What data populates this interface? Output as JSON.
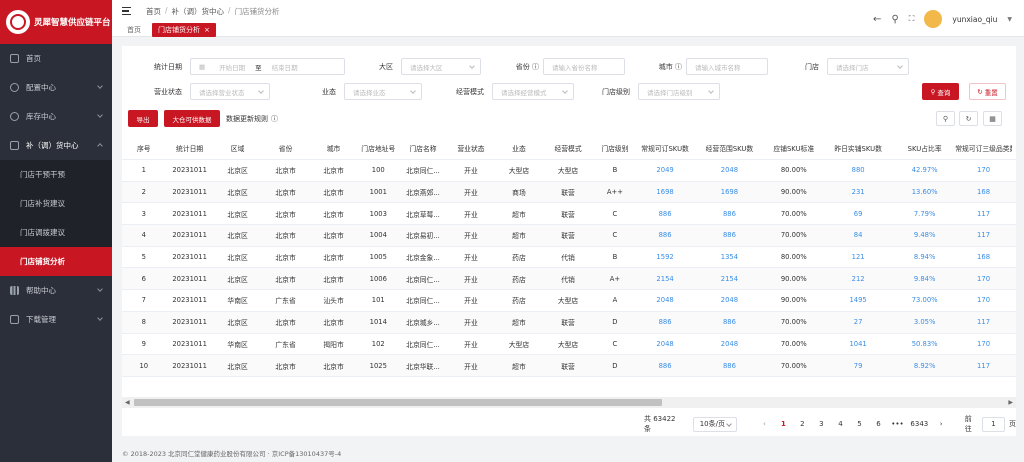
{
  "brand": {
    "name": "灵犀智慧供应链平台"
  },
  "sidebar": {
    "items": [
      {
        "label": "首页"
      },
      {
        "label": "配置中心"
      },
      {
        "label": "库存中心"
      },
      {
        "label": "补（调）货中心"
      },
      {
        "label": "帮助中心"
      },
      {
        "label": "下载管理"
      }
    ],
    "sub_items": [
      {
        "label": "门店干预干预"
      },
      {
        "label": "门店补货建议"
      },
      {
        "label": "门店调拨建议"
      },
      {
        "label": "门店铺货分析"
      }
    ]
  },
  "header": {
    "breadcrumb": [
      "首页",
      "补（调）货中心",
      "门店铺货分析"
    ],
    "tabs": [
      {
        "label": "首页"
      },
      {
        "label": "门店铺货分析"
      }
    ],
    "username": "yunxiao_qiu"
  },
  "filters": {
    "stat_date": "统计日期",
    "start_ph": "开始日期",
    "to": "至",
    "end_ph": "结束日期",
    "region": "大区",
    "region_ph": "请选择大区",
    "province": "省份",
    "province_ph": "请输入省份名称",
    "city": "城市",
    "city_ph": "请输入城市名称",
    "store": "门店",
    "store_ph": "请选择门店",
    "status": "营业状态",
    "status_ph": "请选择营业状态",
    "format": "业态",
    "format_ph": "请选择业态",
    "mode": "经营模式",
    "mode_ph": "请选择经营模式",
    "level": "门店级别",
    "level_ph": "请选择门店级别",
    "query": "查询",
    "reset": "重置"
  },
  "toolbar": {
    "export": "导出",
    "contract": "大仓可供数据",
    "rule": "数据更新规则"
  },
  "table": {
    "columns": [
      "序号",
      "统计日期",
      "区域",
      "省份",
      "城市",
      "门店地址号",
      "门店名称",
      "营业状态",
      "业态",
      "经营模式",
      "门店级别",
      "常规可订SKU数",
      "经营范围SKU数",
      "应铺SKU标准",
      "昨日实铺SKU数",
      "SKU占比率",
      "常规可订三级品类数"
    ],
    "rows": [
      [
        "1",
        "20231011",
        "北京区",
        "北京市",
        "北京市",
        "100",
        "北京同仁...",
        "开业",
        "大型店",
        "大型店",
        "B",
        "2049",
        "2048",
        "80.00%",
        "880",
        "42.97%",
        "170"
      ],
      [
        "2",
        "20231011",
        "北京区",
        "北京市",
        "北京市",
        "1001",
        "北京燕郊...",
        "开业",
        "商场",
        "联营",
        "A++",
        "1698",
        "1698",
        "90.00%",
        "231",
        "13.60%",
        "168"
      ],
      [
        "3",
        "20231011",
        "北京区",
        "北京市",
        "北京市",
        "1003",
        "北京草莓...",
        "开业",
        "超市",
        "联营",
        "C",
        "886",
        "886",
        "70.00%",
        "69",
        "7.79%",
        "117"
      ],
      [
        "4",
        "20231011",
        "北京区",
        "北京市",
        "北京市",
        "1004",
        "北京易初...",
        "开业",
        "超市",
        "联营",
        "C",
        "886",
        "886",
        "70.00%",
        "84",
        "9.48%",
        "117"
      ],
      [
        "5",
        "20231011",
        "北京区",
        "北京市",
        "北京市",
        "1005",
        "北京金象...",
        "开业",
        "药店",
        "代销",
        "B",
        "1592",
        "1354",
        "80.00%",
        "121",
        "8.94%",
        "168"
      ],
      [
        "6",
        "20231011",
        "北京区",
        "北京市",
        "北京市",
        "1006",
        "北京同仁...",
        "开业",
        "药店",
        "代销",
        "A+",
        "2154",
        "2154",
        "90.00%",
        "212",
        "9.84%",
        "170"
      ],
      [
        "7",
        "20231011",
        "华南区",
        "广东省",
        "汕头市",
        "101",
        "北京同仁...",
        "开业",
        "药店",
        "大型店",
        "A",
        "2048",
        "2048",
        "90.00%",
        "1495",
        "73.00%",
        "170"
      ],
      [
        "8",
        "20231011",
        "北京区",
        "北京市",
        "北京市",
        "1014",
        "北京城乡...",
        "开业",
        "超市",
        "联营",
        "D",
        "886",
        "886",
        "70.00%",
        "27",
        "3.05%",
        "117"
      ],
      [
        "9",
        "20231011",
        "华南区",
        "广东省",
        "揭阳市",
        "102",
        "北京同仁...",
        "开业",
        "大型店",
        "大型店",
        "C",
        "2048",
        "2048",
        "70.00%",
        "1041",
        "50.83%",
        "170"
      ],
      [
        "10",
        "20231011",
        "北京区",
        "北京市",
        "北京市",
        "1025",
        "北京华联...",
        "开业",
        "超市",
        "联营",
        "D",
        "886",
        "886",
        "70.00%",
        "79",
        "8.92%",
        "117"
      ]
    ]
  },
  "pager": {
    "total": "共 63422 条",
    "size": "10条/页",
    "pages": [
      "1",
      "2",
      "3",
      "4",
      "5",
      "6",
      "•••",
      "6343"
    ],
    "goto": "前往",
    "page_input": "1",
    "page_unit": "页"
  },
  "footer": "© 2018-2023 北京同仁堂健康药业股份有限公司 · 京ICP备13010437号-4"
}
